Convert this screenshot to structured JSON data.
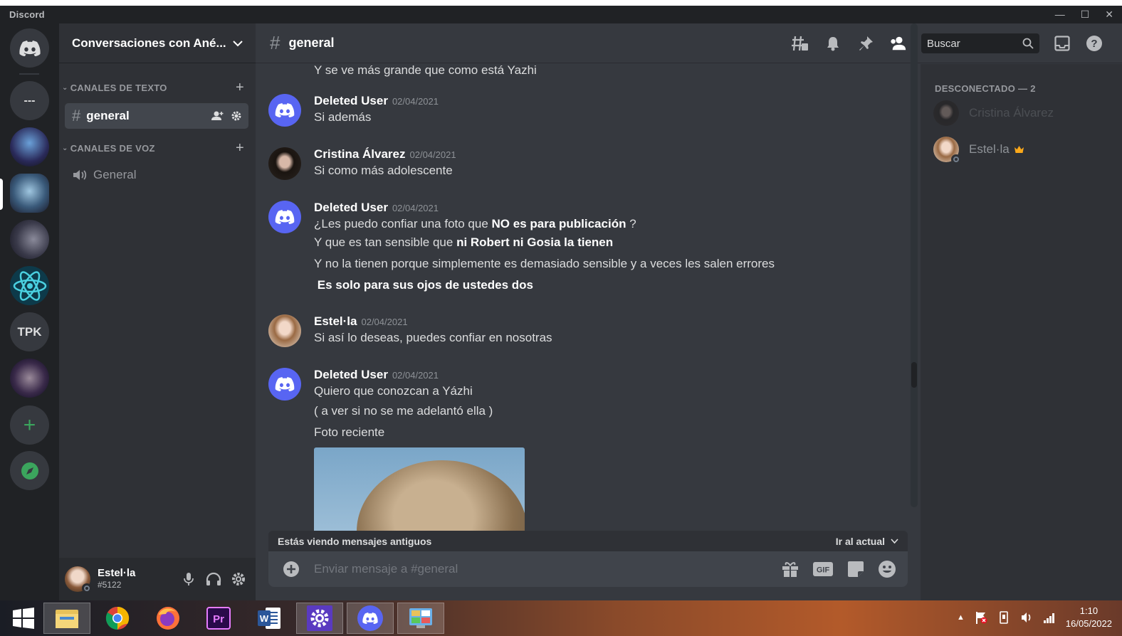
{
  "app": {
    "title": "Discord",
    "window_controls": [
      "—",
      "☐",
      "✕"
    ]
  },
  "guilds": {
    "items": [
      {
        "name": "home",
        "label": ""
      },
      {
        "name": "dm-server",
        "label": "---"
      },
      {
        "name": "server-2",
        "label": ""
      },
      {
        "name": "server-3-active",
        "label": ""
      },
      {
        "name": "server-4",
        "label": ""
      },
      {
        "name": "server-5",
        "label": ""
      },
      {
        "name": "server-tpk",
        "label": "TPK"
      },
      {
        "name": "server-7",
        "label": ""
      }
    ],
    "add_label": "+",
    "explore_label": ""
  },
  "server": {
    "name": "Conversaciones con Ané...",
    "categories": [
      {
        "label": "CANALES DE TEXTO",
        "channels": [
          {
            "label": "general",
            "type": "text"
          }
        ]
      },
      {
        "label": "CANALES DE VOZ",
        "channels": [
          {
            "label": "General",
            "type": "voice"
          }
        ]
      }
    ]
  },
  "user": {
    "name": "Estel·la",
    "tag": "#5122"
  },
  "channel": {
    "name": "general",
    "search_placeholder": "Buscar",
    "composer_placeholder": "Enviar mensaje a #general"
  },
  "messages": [
    {
      "author": "",
      "timestamp": "",
      "lines": [
        "Y se ve más grande que como está Yazhi"
      ]
    },
    {
      "author": "Deleted User",
      "timestamp": "02/04/2021",
      "lines": [
        "Si además"
      ]
    },
    {
      "author": "Cristina Álvarez",
      "timestamp": "02/04/2021",
      "lines": [
        "Si como más adolescente"
      ]
    },
    {
      "author": "Deleted User",
      "timestamp": "02/04/2021",
      "lines": [
        {
          "pre": "¿Les puedo confiar una foto que ",
          "bold": "NO es para publicación",
          "post": " ?"
        },
        {
          "pre": "Y que es tan sensible que ",
          "bold": "ni Robert ni  Gosia  la tienen",
          "post": ""
        },
        {
          "pre": "Y no la tienen porque simplemente es demasiado sensible y a veces les salen errores",
          "bold": "",
          "post": ""
        },
        {
          "pre": " ",
          "bold": "Es solo para sus ojos de ustedes dos",
          "post": ""
        }
      ]
    },
    {
      "author": "Estel·la",
      "timestamp": "02/04/2021",
      "lines": [
        "Si así lo deseas, puedes confiar en nosotras"
      ]
    },
    {
      "author": "Deleted User",
      "timestamp": "02/04/2021",
      "lines": [
        "Quiero que conozcan a Yázhi",
        "( a ver si no se me adelantó ella )",
        "Foto reciente"
      ]
    }
  ],
  "old_messages_bar": {
    "text": "Estás viendo mensajes antiguos",
    "jump_label": "Ir al actual"
  },
  "members": {
    "section_label": "DESCONECTADO — 2",
    "list": [
      {
        "name": "Cristina Álvarez",
        "crown": false
      },
      {
        "name": "Estel·la",
        "crown": true
      }
    ]
  },
  "taskbar": {
    "apps": [
      "windows-start",
      "file-explorer",
      "chrome",
      "firefox",
      "premiere",
      "word",
      "settings",
      "discord",
      "control-panel"
    ],
    "time": "1:10",
    "date": "16/05/2022"
  },
  "colors": {
    "blurple": "#5865f2",
    "green": "#3ba55d",
    "background": "#36393f",
    "sidebar": "#2f3136",
    "guilds": "#202225"
  }
}
